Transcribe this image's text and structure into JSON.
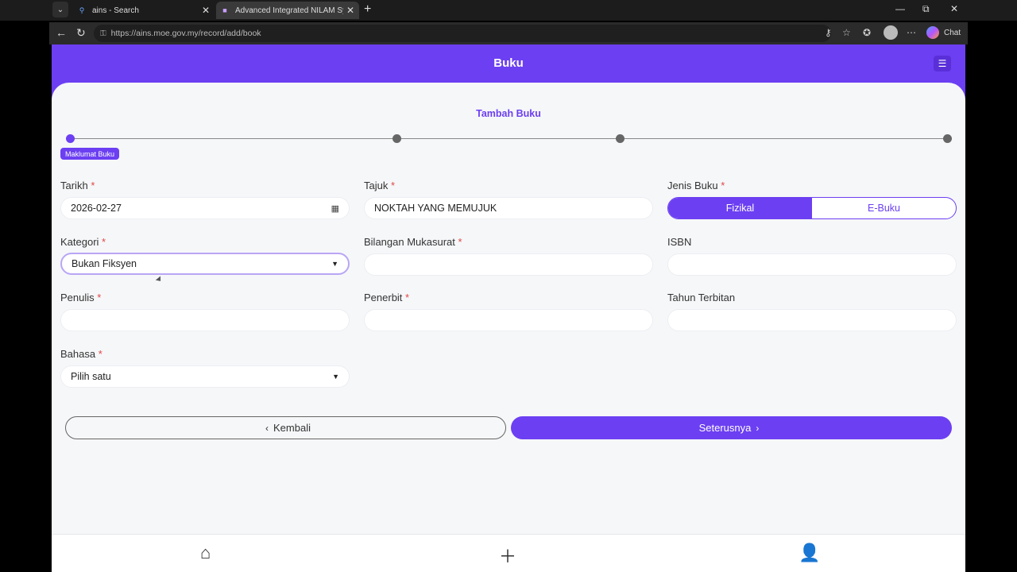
{
  "browser": {
    "tabs": [
      {
        "label": "ains - Search",
        "icon": "search-icon"
      },
      {
        "label": "Advanced Integrated NILAM Syste",
        "icon": "site-icon"
      }
    ],
    "url": "https://ains.moe.gov.my/record/add/book",
    "chat_label": "Chat"
  },
  "header": {
    "title": "Buku"
  },
  "form": {
    "title": "Tambah Buku",
    "step_badge": "Maklumat Buku",
    "fields": {
      "tarikh": {
        "label": "Tarikh",
        "value": "2026-02-27"
      },
      "tajuk": {
        "label": "Tajuk",
        "value": "NOKTAH YANG MEMUJUK"
      },
      "jenis_buku": {
        "label": "Jenis Buku",
        "options": [
          "Fizikal",
          "E-Buku"
        ],
        "selected": "Fizikal"
      },
      "kategori": {
        "label": "Kategori",
        "value": "Bukan Fiksyen"
      },
      "bilangan_mukasurat": {
        "label": "Bilangan Mukasurat",
        "value": ""
      },
      "isbn": {
        "label": "ISBN",
        "value": ""
      },
      "penulis": {
        "label": "Penulis",
        "value": ""
      },
      "penerbit": {
        "label": "Penerbit",
        "value": ""
      },
      "tahun_terbitan": {
        "label": "Tahun Terbitan",
        "value": ""
      },
      "bahasa": {
        "label": "Bahasa",
        "value": "Pilih satu"
      }
    },
    "required_mark": "*"
  },
  "buttons": {
    "back": "Kembali",
    "next": "Seterusnya"
  },
  "colors": {
    "accent": "#6c3ff2",
    "required": "#e04848"
  }
}
